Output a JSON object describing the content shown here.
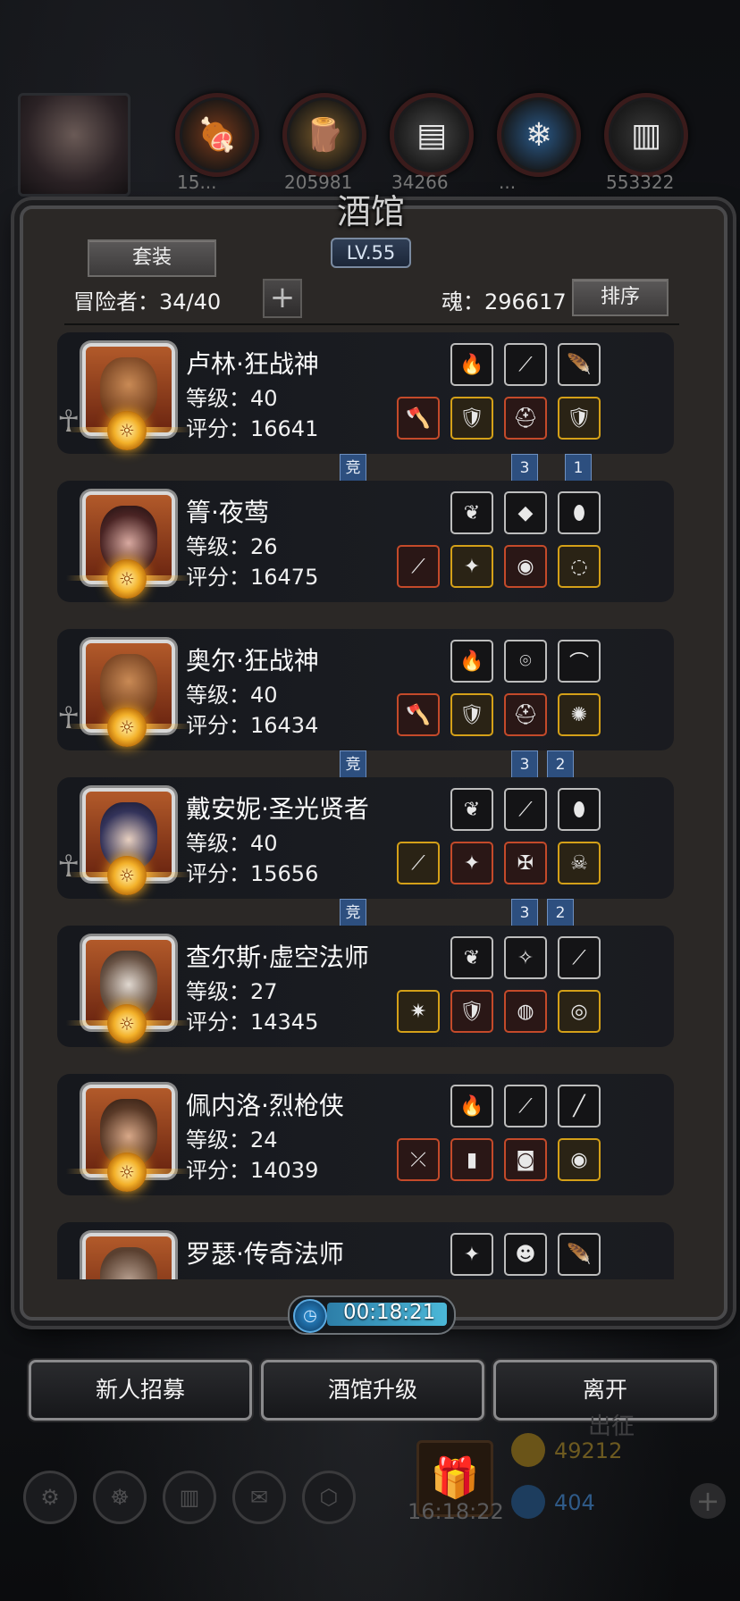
{
  "top_bar": {
    "resources": [
      {
        "icon": "meat-icon",
        "value": "15..."
      },
      {
        "icon": "wood-icon",
        "value": "205981"
      },
      {
        "icon": "iron-icon",
        "value": "34266"
      },
      {
        "icon": "crystal-icon",
        "value": "..."
      },
      {
        "icon": "steel-icon",
        "value": "553322"
      }
    ]
  },
  "tavern": {
    "title": "酒馆",
    "level": "LV.55",
    "set_button": "套装",
    "adventurers_label": "冒险者：34/40",
    "soul_label": "魂：296617",
    "sort_button": "排序",
    "add_symbol": "+"
  },
  "heroes": [
    {
      "name": "卢林·狂战神",
      "level": "等级：40",
      "score": "评分：16641",
      "portrait": "berserker",
      "ghost": true,
      "equip_top": [
        {
          "icon": "fire-orb-icon",
          "glyph": "🔥",
          "tier": "plain"
        },
        {
          "icon": "bow-icon",
          "glyph": "⟋",
          "tier": "plain"
        },
        {
          "icon": "feather-icon",
          "glyph": "🪶",
          "tier": "plain"
        }
      ],
      "equip_bottom": [
        {
          "icon": "axe-icon",
          "glyph": "🪓",
          "tier": "red"
        },
        {
          "icon": "armor-icon",
          "glyph": "🛡",
          "tier": "gold"
        },
        {
          "icon": "helmet-icon",
          "glyph": "⛑",
          "tier": "red"
        },
        {
          "icon": "shield-icon",
          "glyph": "🛡",
          "tier": "gold"
        }
      ],
      "ribbons": [
        {
          "text": "竞",
          "col": "mid"
        },
        {
          "text": "3",
          "col": "c2"
        },
        {
          "text": "1",
          "col": "c4"
        }
      ]
    },
    {
      "name": "箐·夜莺",
      "level": "等级：26",
      "score": "评分：16475",
      "portrait": "nightingale",
      "ghost": false,
      "equip_top": [
        {
          "icon": "green-flame-icon",
          "glyph": "❦",
          "tier": "plain"
        },
        {
          "icon": "purple-gem-icon",
          "glyph": "◆",
          "tier": "plain"
        },
        {
          "icon": "shield-icon",
          "glyph": "⬮",
          "tier": "plain"
        }
      ],
      "equip_bottom": [
        {
          "icon": "staff-icon",
          "glyph": "⟋",
          "tier": "red"
        },
        {
          "icon": "armor-icon",
          "glyph": "✦",
          "tier": "gold"
        },
        {
          "icon": "eye-icon",
          "glyph": "◉",
          "tier": "red"
        },
        {
          "icon": "ring-icon",
          "glyph": "◌",
          "tier": "gold"
        }
      ],
      "ribbons": []
    },
    {
      "name": "奥尔·狂战神",
      "level": "等级：40",
      "score": "评分：16434",
      "portrait": "berserker",
      "ghost": true,
      "equip_top": [
        {
          "icon": "fire-orb-icon",
          "glyph": "🔥",
          "tier": "plain"
        },
        {
          "icon": "necklace-icon",
          "glyph": "⌾",
          "tier": "plain"
        },
        {
          "icon": "horn-icon",
          "glyph": "⌒",
          "tier": "plain"
        }
      ],
      "equip_bottom": [
        {
          "icon": "axe-icon",
          "glyph": "🪓",
          "tier": "red"
        },
        {
          "icon": "armor-icon",
          "glyph": "🛡",
          "tier": "gold"
        },
        {
          "icon": "helmet-icon",
          "glyph": "⛑",
          "tier": "red"
        },
        {
          "icon": "amulet-icon",
          "glyph": "✺",
          "tier": "gold"
        }
      ],
      "ribbons": [
        {
          "text": "竞",
          "col": "mid"
        },
        {
          "text": "3",
          "col": "c2"
        },
        {
          "text": "2",
          "col": "c3"
        }
      ]
    },
    {
      "name": "戴安妮·圣光贤者",
      "level": "等级：40",
      "score": "评分：15656",
      "portrait": "sage",
      "ghost": true,
      "equip_top": [
        {
          "icon": "green-flame-icon",
          "glyph": "❦",
          "tier": "plain"
        },
        {
          "icon": "bow-icon",
          "glyph": "⟋",
          "tier": "plain"
        },
        {
          "icon": "shield-icon",
          "glyph": "⬮",
          "tier": "plain"
        }
      ],
      "equip_bottom": [
        {
          "icon": "staff-icon",
          "glyph": "⟋",
          "tier": "gold"
        },
        {
          "icon": "armor-icon",
          "glyph": "✦",
          "tier": "red"
        },
        {
          "icon": "medal-icon",
          "glyph": "✠",
          "tier": "red"
        },
        {
          "icon": "mask-icon",
          "glyph": "☠",
          "tier": "gold"
        }
      ],
      "ribbons": [
        {
          "text": "竞",
          "col": "mid"
        },
        {
          "text": "3",
          "col": "c2"
        },
        {
          "text": "2",
          "col": "c3"
        }
      ]
    },
    {
      "name": "查尔斯·虚空法师",
      "level": "等级：27",
      "score": "评分：14345",
      "portrait": "void-mage",
      "ghost": false,
      "equip_top": [
        {
          "icon": "green-flame-icon",
          "glyph": "❦",
          "tier": "plain"
        },
        {
          "icon": "emblem-icon",
          "glyph": "✧",
          "tier": "plain"
        },
        {
          "icon": "bow-icon",
          "glyph": "⟋",
          "tier": "plain"
        }
      ],
      "equip_bottom": [
        {
          "icon": "scepter-icon",
          "glyph": "✷",
          "tier": "gold"
        },
        {
          "icon": "armor-icon",
          "glyph": "🛡",
          "tier": "red"
        },
        {
          "icon": "ring-icon",
          "glyph": "◍",
          "tier": "red"
        },
        {
          "icon": "bracelet-icon",
          "glyph": "◎",
          "tier": "gold"
        }
      ],
      "ribbons": []
    },
    {
      "name": "佩内洛·烈枪侠",
      "level": "等级：24",
      "score": "评分：14039",
      "portrait": "gunner",
      "ghost": false,
      "equip_top": [
        {
          "icon": "fire-orb-icon",
          "glyph": "🔥",
          "tier": "plain"
        },
        {
          "icon": "bow-icon",
          "glyph": "⟋",
          "tier": "plain"
        },
        {
          "icon": "blade-icon",
          "glyph": "╱",
          "tier": "plain"
        }
      ],
      "equip_bottom": [
        {
          "icon": "gun-icon",
          "glyph": "⤫",
          "tier": "red"
        },
        {
          "icon": "armor-icon",
          "glyph": "▮",
          "tier": "red"
        },
        {
          "icon": "helmet-icon",
          "glyph": "◙",
          "tier": "red"
        },
        {
          "icon": "eye-icon",
          "glyph": "◉",
          "tier": "gold"
        }
      ],
      "ribbons": []
    },
    {
      "name": "罗瑟·传奇法师",
      "level": "",
      "score": "",
      "portrait": "legend-mage",
      "ghost": false,
      "equip_top": [
        {
          "icon": "armor-icon",
          "glyph": "✦",
          "tier": "plain"
        },
        {
          "icon": "mask-icon",
          "glyph": "☻",
          "tier": "plain"
        },
        {
          "icon": "feather-icon",
          "glyph": "🪶",
          "tier": "plain"
        }
      ],
      "equip_bottom": [],
      "ribbons": []
    }
  ],
  "timer": "00:18:21",
  "buttons": {
    "recruit": "新人招募",
    "upgrade": "酒馆升级",
    "leave": "离开"
  },
  "hud": {
    "expedition": "出征",
    "gold": "49212",
    "gems": "404",
    "clock": "16:18:22"
  },
  "colors": {
    "accent_blue": "#2d4f7f",
    "gold_border": "#d4a018",
    "red_border": "#c44a2a"
  }
}
